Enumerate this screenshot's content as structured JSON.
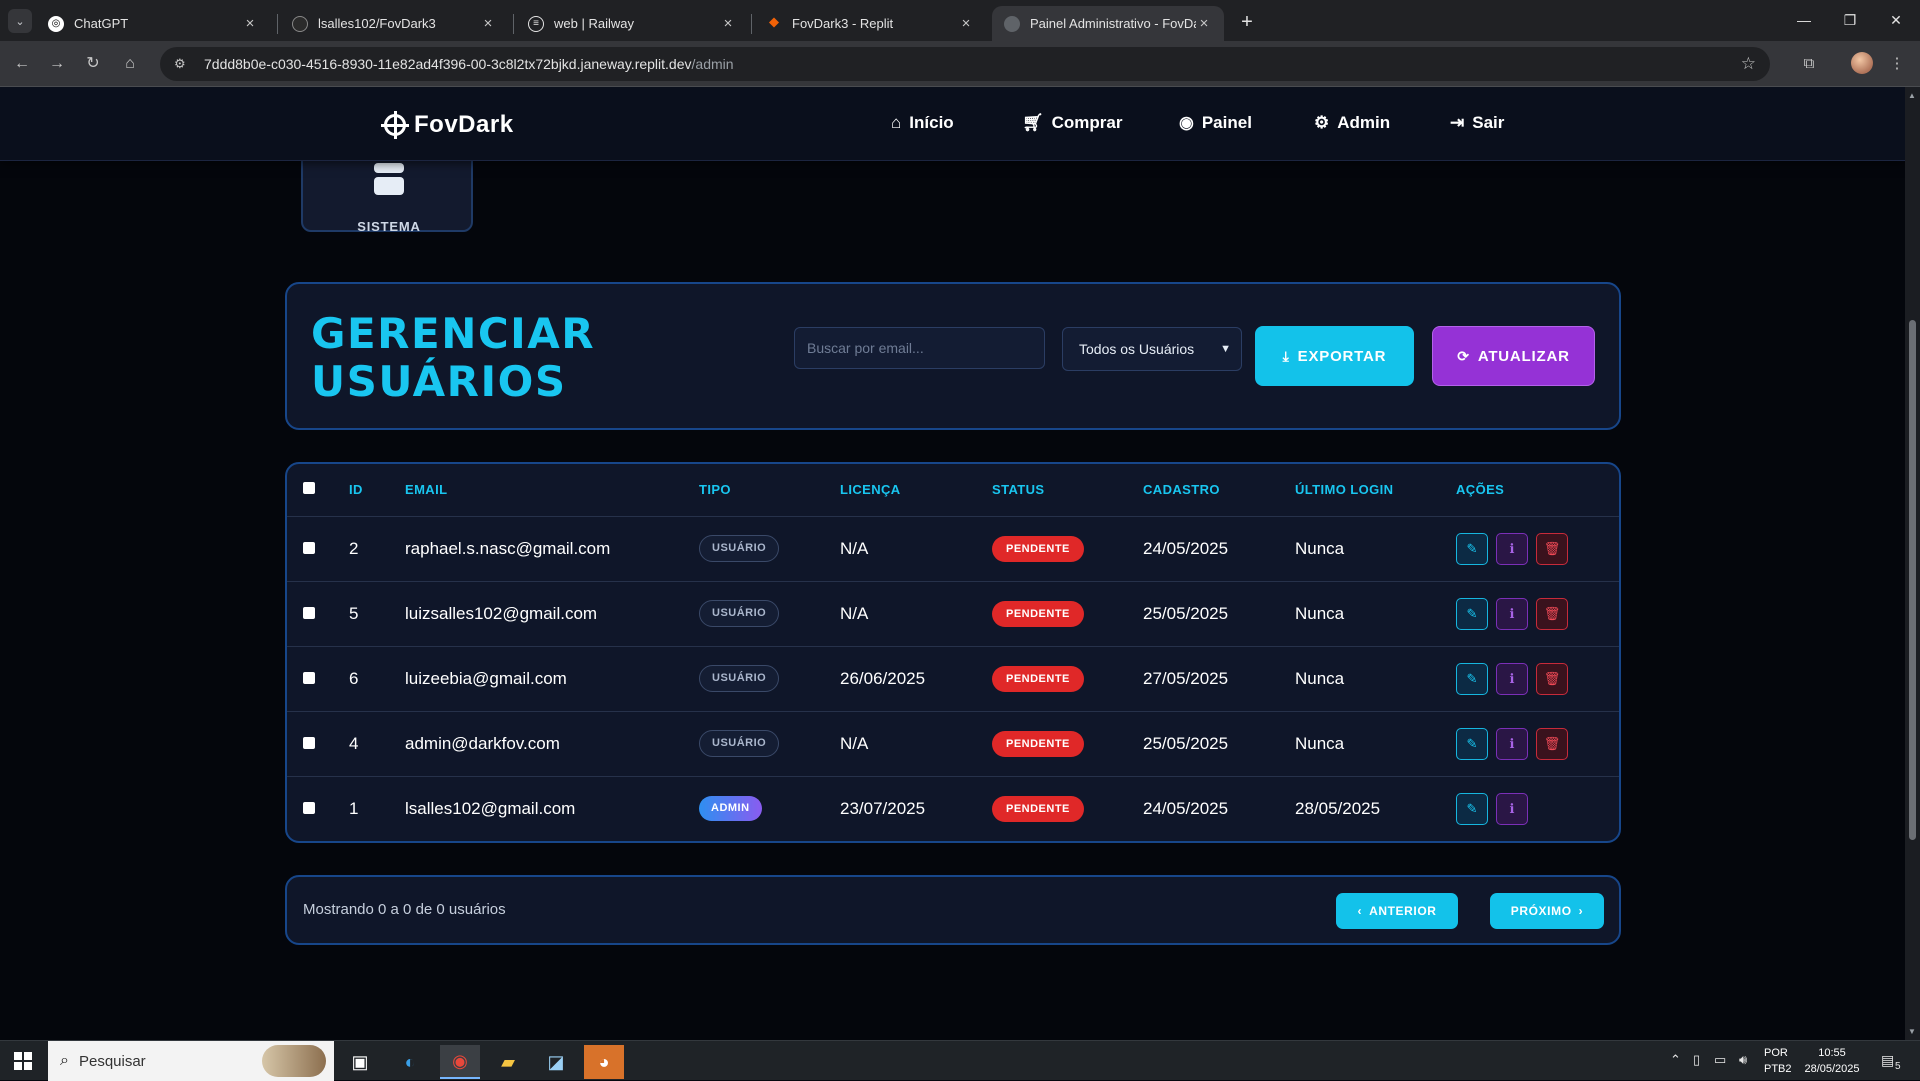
{
  "browser": {
    "tabs": [
      {
        "title": "ChatGPT",
        "active": false
      },
      {
        "title": "lsalles102/FovDark3",
        "active": false
      },
      {
        "title": "web | Railway",
        "active": false
      },
      {
        "title": "FovDark3 - Replit",
        "active": false
      },
      {
        "title": "Painel Administrativo - FovDark",
        "active": true
      }
    ],
    "url_host": "7ddd8b0e-c030-4516-8930-11e82ad4f396-00-3c8l2tx72bjkd.janeway.replit.dev",
    "url_path": "/admin"
  },
  "site": {
    "logo": "FovDark",
    "nav": [
      {
        "label": "Início",
        "icon": "home-icon"
      },
      {
        "label": "Comprar",
        "icon": "cart-icon"
      },
      {
        "label": "Painel",
        "icon": "gauge-icon"
      },
      {
        "label": "Admin",
        "icon": "gear-icon"
      },
      {
        "label": "Sair",
        "icon": "logout-icon"
      }
    ]
  },
  "system_card": {
    "label": "SISTEMA",
    "icon": "server-icon"
  },
  "manage": {
    "title_line1": "GERENCIAR",
    "title_line2": "USUÁRIOS",
    "search_placeholder": "Buscar por email...",
    "filter_value": "Todos os Usuários",
    "export_label": "EXPORTAR",
    "refresh_label": "ATUALIZAR"
  },
  "table": {
    "headers": {
      "id": "ID",
      "email": "EMAIL",
      "tipo": "TIPO",
      "licenca": "LICENÇA",
      "status": "STATUS",
      "cadastro": "CADASTRO",
      "ultimo_login": "ÚLTIMO LOGIN",
      "acoes": "AÇÕES"
    },
    "rows": [
      {
        "id": "2",
        "email": "raphael.s.nasc@gmail.com",
        "tipo": "USUÁRIO",
        "licenca": "N/A",
        "status": "PENDENTE",
        "cadastro": "24/05/2025",
        "ultimo_login": "Nunca"
      },
      {
        "id": "5",
        "email": "luizsalles102@gmail.com",
        "tipo": "USUÁRIO",
        "licenca": "N/A",
        "status": "PENDENTE",
        "cadastro": "25/05/2025",
        "ultimo_login": "Nunca"
      },
      {
        "id": "6",
        "email": "luizeebia@gmail.com",
        "tipo": "USUÁRIO",
        "licenca": "26/06/2025",
        "status": "PENDENTE",
        "cadastro": "27/05/2025",
        "ultimo_login": "Nunca"
      },
      {
        "id": "4",
        "email": "admin@darkfov.com",
        "tipo": "USUÁRIO",
        "licenca": "N/A",
        "status": "PENDENTE",
        "cadastro": "25/05/2025",
        "ultimo_login": "Nunca"
      },
      {
        "id": "1",
        "email": "lsalles102@gmail.com",
        "tipo": "ADMIN",
        "licenca": "23/07/2025",
        "status": "PENDENTE",
        "cadastro": "24/05/2025",
        "ultimo_login": "28/05/2025"
      }
    ]
  },
  "pagination": {
    "summary": "Mostrando 0 a 0 de 0 usuários",
    "prev_label": "ANTERIOR",
    "next_label": "PRÓXIMO"
  },
  "taskbar": {
    "search_placeholder": "Pesquisar",
    "lang_line1": "POR",
    "lang_line2": "PTB2",
    "time": "10:55",
    "date": "28/05/2025",
    "notifications": "5"
  },
  "colors": {
    "accent_cyan": "#19c6f0",
    "accent_purple": "#9532d6",
    "status_red": "#e02828"
  }
}
